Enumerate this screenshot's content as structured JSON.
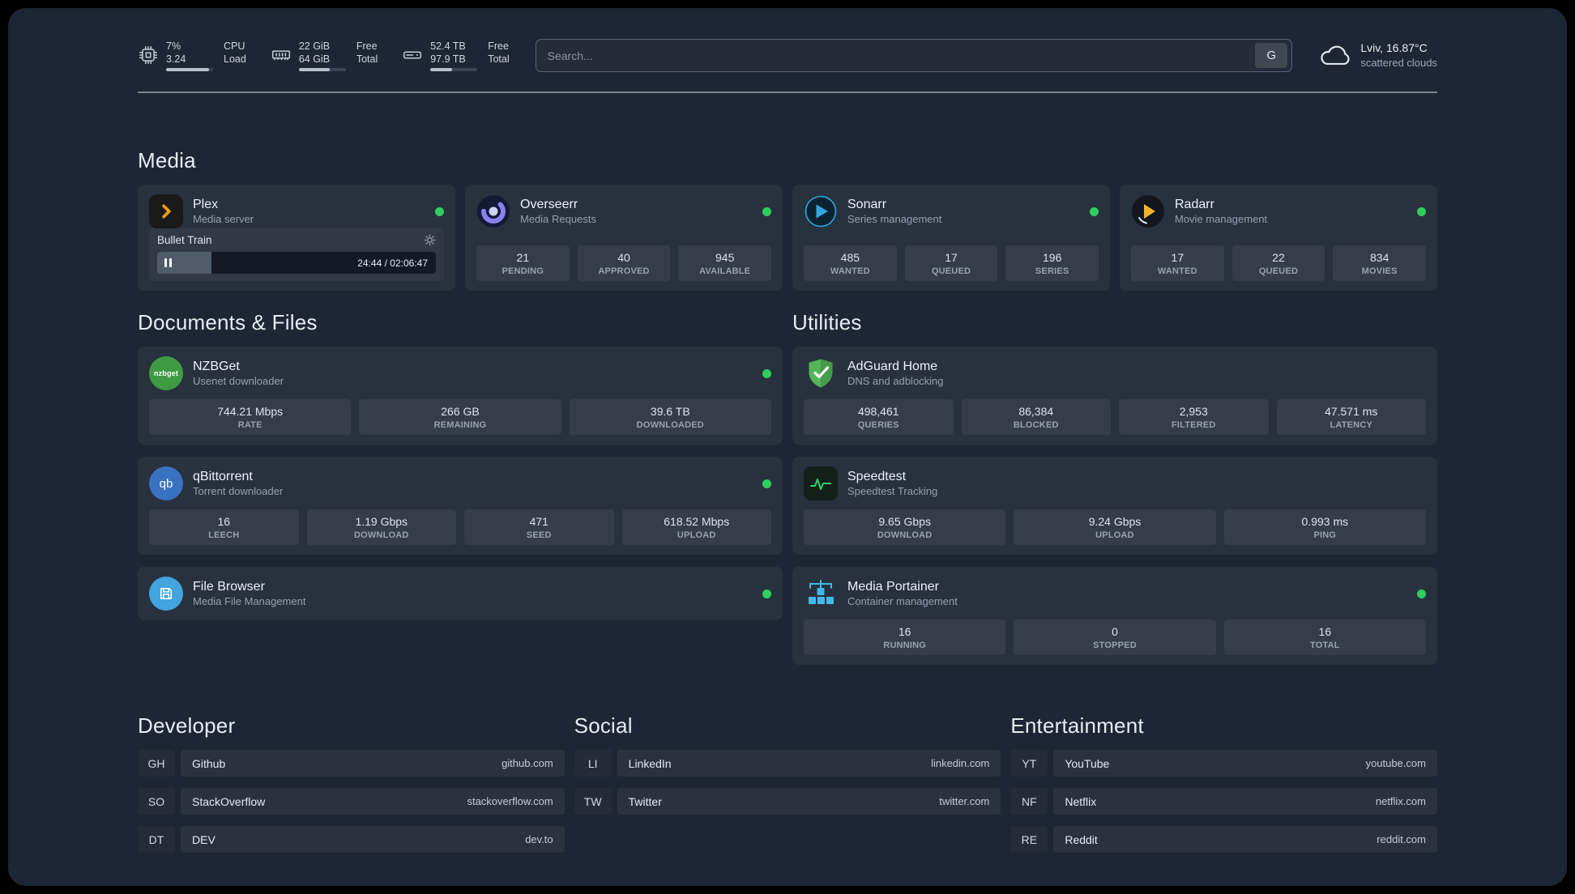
{
  "topbar": {
    "cpu": {
      "usage": "7%",
      "load": "3.24",
      "label_top": "CPU",
      "label_bottom": "Load",
      "bar_pct": 92
    },
    "memory": {
      "free": "22 GiB",
      "total": "64 GiB",
      "label_top": "Free",
      "label_bottom": "Total",
      "bar_pct": 66
    },
    "disk": {
      "free": "52.4 TB",
      "total": "97.9 TB",
      "label_top": "Free",
      "label_bottom": "Total",
      "bar_pct": 47
    },
    "search": {
      "placeholder": "Search...",
      "provider_label": "G"
    },
    "weather": {
      "location": "Lviv, 16.87°C",
      "condition": "scattered clouds"
    }
  },
  "sections": {
    "media": "Media",
    "documents": "Documents & Files",
    "utilities": "Utilities",
    "developer": "Developer",
    "social": "Social",
    "entertainment": "Entertainment"
  },
  "media_cards": [
    {
      "name": "Plex",
      "desc": "Media server",
      "online": true,
      "player": {
        "title": "Bullet Train",
        "time": "24:44 / 02:06:47",
        "progress_pct": 19.5
      }
    },
    {
      "name": "Overseerr",
      "desc": "Media Requests",
      "online": true,
      "stats": [
        {
          "value": "21",
          "label": "PENDING"
        },
        {
          "value": "40",
          "label": "APPROVED"
        },
        {
          "value": "945",
          "label": "AVAILABLE"
        }
      ]
    },
    {
      "name": "Sonarr",
      "desc": "Series management",
      "online": true,
      "stats": [
        {
          "value": "485",
          "label": "WANTED"
        },
        {
          "value": "17",
          "label": "QUEUED"
        },
        {
          "value": "196",
          "label": "SERIES"
        }
      ]
    },
    {
      "name": "Radarr",
      "desc": "Movie management",
      "online": true,
      "stats": [
        {
          "value": "17",
          "label": "WANTED"
        },
        {
          "value": "22",
          "label": "QUEUED"
        },
        {
          "value": "834",
          "label": "MOVIES"
        }
      ]
    }
  ],
  "documents_cards": [
    {
      "name": "NZBGet",
      "desc": "Usenet downloader",
      "online": true,
      "stats": [
        {
          "value": "744.21 Mbps",
          "label": "RATE"
        },
        {
          "value": "266 GB",
          "label": "REMAINING"
        },
        {
          "value": "39.6 TB",
          "label": "DOWNLOADED"
        }
      ]
    },
    {
      "name": "qBittorrent",
      "desc": "Torrent downloader",
      "online": true,
      "stats": [
        {
          "value": "16",
          "label": "LEECH"
        },
        {
          "value": "1.19 Gbps",
          "label": "DOWNLOAD"
        },
        {
          "value": "471",
          "label": "SEED"
        },
        {
          "value": "618.52 Mbps",
          "label": "UPLOAD"
        }
      ]
    },
    {
      "name": "File Browser",
      "desc": "Media File Management",
      "online": true
    }
  ],
  "utilities_cards": [
    {
      "name": "AdGuard Home",
      "desc": "DNS and adblocking",
      "online": false,
      "stats": [
        {
          "value": "498,461",
          "label": "QUERIES"
        },
        {
          "value": "86,384",
          "label": "BLOCKED"
        },
        {
          "value": "2,953",
          "label": "FILTERED"
        },
        {
          "value": "47.571 ms",
          "label": "LATENCY"
        }
      ]
    },
    {
      "name": "Speedtest",
      "desc": "Speedtest Tracking",
      "online": false,
      "stats": [
        {
          "value": "9.65 Gbps",
          "label": "DOWNLOAD"
        },
        {
          "value": "9.24 Gbps",
          "label": "UPLOAD"
        },
        {
          "value": "0.993 ms",
          "label": "PING"
        }
      ]
    },
    {
      "name": "Media Portainer",
      "desc": "Container management",
      "online": true,
      "stats": [
        {
          "value": "16",
          "label": "RUNNING"
        },
        {
          "value": "0",
          "label": "STOPPED"
        },
        {
          "value": "16",
          "label": "TOTAL"
        }
      ]
    }
  ],
  "bookmarks": {
    "developer": [
      {
        "abbr": "GH",
        "name": "Github",
        "domain": "github.com"
      },
      {
        "abbr": "SO",
        "name": "StackOverflow",
        "domain": "stackoverflow.com"
      },
      {
        "abbr": "DT",
        "name": "DEV",
        "domain": "dev.to"
      }
    ],
    "social": [
      {
        "abbr": "LI",
        "name": "LinkedIn",
        "domain": "linkedin.com"
      },
      {
        "abbr": "TW",
        "name": "Twitter",
        "domain": "twitter.com"
      }
    ],
    "entertainment": [
      {
        "abbr": "YT",
        "name": "YouTube",
        "domain": "youtube.com"
      },
      {
        "abbr": "NF",
        "name": "Netflix",
        "domain": "netflix.com"
      },
      {
        "abbr": "RE",
        "name": "Reddit",
        "domain": "reddit.com"
      }
    ]
  },
  "icon_text": {
    "nzbget": "nzbget",
    "qbittorrent": "qb"
  },
  "colors": {
    "background": "#1d2634",
    "status_online": "#2fce5f",
    "plex_accent": "#e5a00d",
    "adguard_green": "#53b458",
    "portainer_blue": "#41b9e8",
    "speedtest_green": "#2fd06a"
  }
}
